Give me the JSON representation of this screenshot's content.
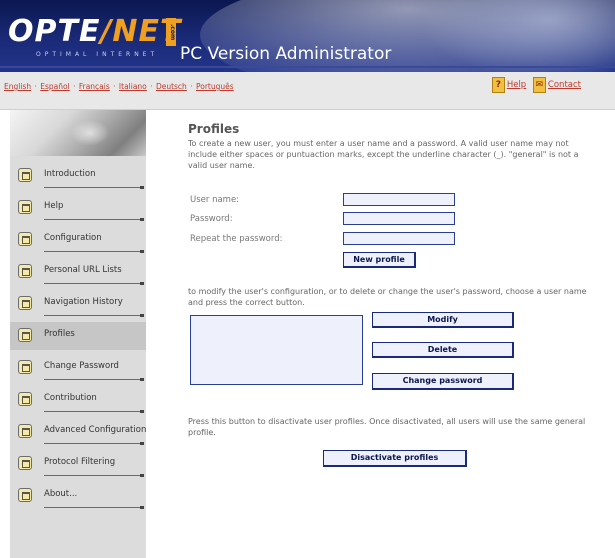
{
  "header": {
    "logo_opte": "OPTE",
    "logo_net": "/NET",
    "logo_com": ".com",
    "logo_tagline": "OPTIMAL INTERNET",
    "app_title": "PC Version Administrator"
  },
  "languages": [
    "English",
    "Español",
    "Français",
    "Italiano",
    "Deutsch",
    "Português"
  ],
  "toplinks": {
    "help_icon": "help-icon",
    "help": "Help",
    "contact_icon": "contact-icon",
    "contact": "Contact"
  },
  "sidebar": {
    "items": [
      {
        "label": "Introduction",
        "icon": "folder-icon"
      },
      {
        "label": "Help",
        "icon": "folder-icon"
      },
      {
        "label": "Configuration",
        "icon": "folder-icon"
      },
      {
        "label": "Personal URL Lists",
        "icon": "folder-icon"
      },
      {
        "label": "Navigation History",
        "icon": "folder-icon"
      },
      {
        "label": "Profiles",
        "icon": "folder-icon",
        "active": true
      },
      {
        "label": "Change Password",
        "icon": "folder-icon"
      },
      {
        "label": "Contribution",
        "icon": "folder-icon"
      },
      {
        "label": "Advanced Configuration",
        "icon": "folder-icon"
      },
      {
        "label": "Protocol Filtering",
        "icon": "folder-icon"
      },
      {
        "label": "About...",
        "icon": "folder-icon"
      }
    ]
  },
  "main": {
    "title": "Profiles",
    "intro": "To create a new user, you must enter a user name and a password. A valid user name may not include either spaces or puntuaction marks, except the underline character (_). \"general\" is not a valid user name.",
    "username_label": "User name:",
    "username_value": "",
    "password_label": "Password:",
    "password_value": "",
    "repeat_label": "Repeat the password:",
    "repeat_value": "",
    "new_profile_button": "New profile",
    "modify_text": "to modify the user's configuration, or to delete or change the user's password, choose a user name and press the correct button.",
    "user_list_items": [],
    "modify_button": "Modify",
    "delete_button": "Delete",
    "change_password_button": "Change password",
    "deactivate_text": "Press this button to disactivate user profiles. Once disactivated, all users will use the same general profile.",
    "deactivate_button": "Disactivate profiles"
  },
  "colors": {
    "header_bg": "#1a2a78",
    "link": "#c0392b",
    "button_border": "#1a2a78",
    "input_bg": "#eef0fb",
    "sidebar_bg": "#dcdcdc"
  }
}
